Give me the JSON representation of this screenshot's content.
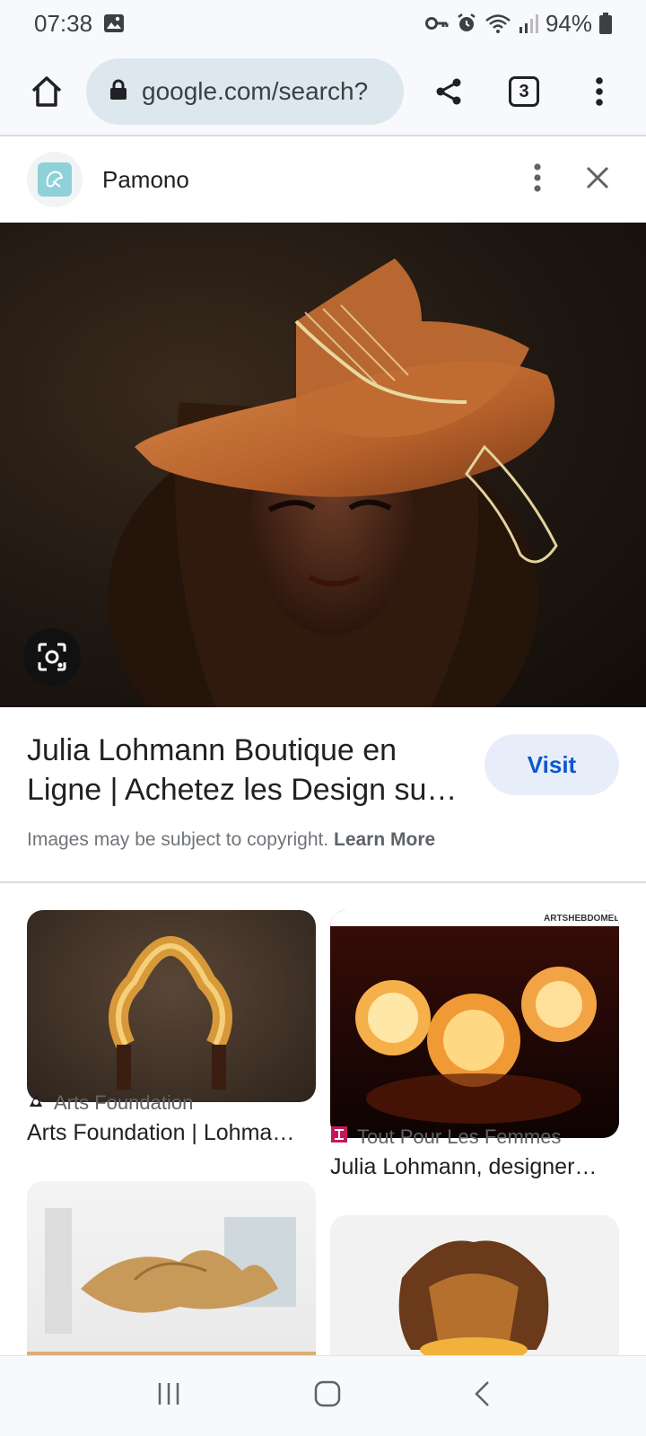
{
  "status_bar": {
    "time": "07:38",
    "battery": "94%",
    "icons": [
      "image-icon",
      "key-icon",
      "alarm-icon",
      "wifi-icon",
      "signal-icon",
      "battery-icon"
    ]
  },
  "browser": {
    "url": "google.com/search?",
    "tab_count": "3",
    "icons": [
      "home-icon",
      "lock-icon",
      "share-icon",
      "tabs-icon",
      "more-vert-icon"
    ]
  },
  "source": {
    "name": "Pamono",
    "icons": [
      "pamono-logo-icon",
      "more-vert-icon",
      "close-icon"
    ]
  },
  "hero": {
    "description_icon": "lens-icon"
  },
  "result": {
    "title": "Julia Lohmann Boutique en Ligne | Achetez les Design su…",
    "visit_label": "Visit",
    "copyright_text": "Images may be subject to copyright. ",
    "learn_more": "Learn More"
  },
  "related": [
    {
      "source": "Arts Foundation",
      "title": "Arts Foundation | Lohma…"
    },
    {
      "source": "Tout Pour Les Femmes",
      "title": "Julia Lohmann, designer…"
    },
    {
      "source": "",
      "title": ""
    },
    {
      "source": "",
      "title": ""
    }
  ],
  "related_badge_text": "ARTSHEBDOMEDIA",
  "navbar": {
    "icons": [
      "recents-icon",
      "home-nav-icon",
      "back-icon"
    ]
  },
  "colors": {
    "accent": "#0b57d0",
    "visit_bg": "#e8eef9",
    "url_bg": "#dde7ee"
  }
}
